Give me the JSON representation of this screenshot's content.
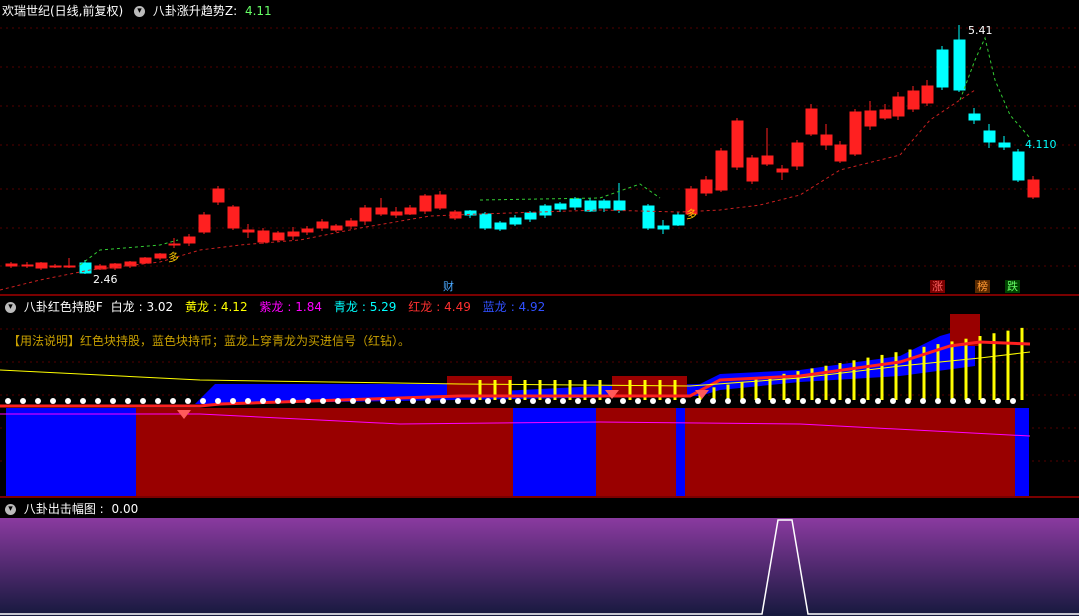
{
  "panel1": {
    "stock_name": "欢瑞世纪(日线,前复权)",
    "indicator_name": "八卦涨升趋势Z",
    "indicator_value": "4.11",
    "labels": {
      "high": "5.41",
      "low": "2.46",
      "last": "4.110",
      "duo1": "多",
      "duo2": "多"
    },
    "tags": [
      {
        "text": "财",
        "color": "#4aa8ff",
        "bg": "#000"
      },
      {
        "text": "涨",
        "color": "#ff6060",
        "bg": "#7a0000"
      },
      {
        "text": "榜",
        "color": "#ff9933",
        "bg": "#5a2a00"
      },
      {
        "text": "跌",
        "color": "#66ff66",
        "bg": "#004400"
      }
    ]
  },
  "panel2": {
    "indicator_name": "八卦红色持股F",
    "values": [
      {
        "label": "白龙",
        "value": "3.02",
        "color": "#ffffff"
      },
      {
        "label": "黄龙",
        "value": "4.12",
        "color": "#ffff00"
      },
      {
        "label": "紫龙",
        "value": "1.84",
        "color": "#ff00ff"
      },
      {
        "label": "青龙",
        "value": "5.29",
        "color": "#00ffff"
      },
      {
        "label": "红龙",
        "value": "4.49",
        "color": "#ff3030"
      },
      {
        "label": "蓝龙",
        "value": "4.92",
        "color": "#3050ff"
      }
    ],
    "note": "【用法说明】红色块持股，蓝色块持币；蓝龙上穿青龙为买进信号（红钻）。"
  },
  "panel3": {
    "indicator_name": "八卦出击幅图",
    "indicator_value": "0.00"
  },
  "colors": {
    "up": "#ff2020",
    "down": "#00ffff",
    "red_block": "#990000",
    "blue_block": "#0000ff"
  }
}
